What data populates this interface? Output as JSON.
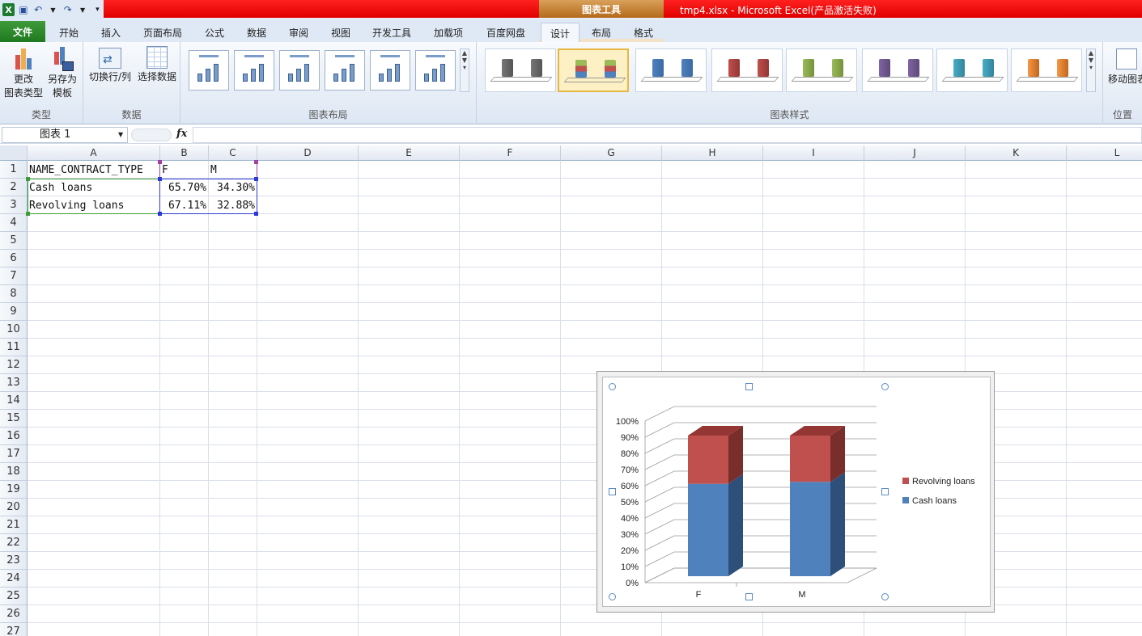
{
  "window": {
    "title": "tmp4.xlsx  -  Microsoft Excel(产品激活失败)",
    "context_group": "图表工具"
  },
  "ribbon_tabs": [
    {
      "label": "文件"
    },
    {
      "label": "开始"
    },
    {
      "label": "插入"
    },
    {
      "label": "页面布局"
    },
    {
      "label": "公式"
    },
    {
      "label": "数据"
    },
    {
      "label": "审阅"
    },
    {
      "label": "视图"
    },
    {
      "label": "开发工具"
    },
    {
      "label": "加载项"
    },
    {
      "label": "百度网盘"
    },
    {
      "label": "设计"
    },
    {
      "label": "布局"
    },
    {
      "label": "格式"
    }
  ],
  "ribbon": {
    "type_group": {
      "label": "类型",
      "change_type": "更改\n图表类型",
      "save_template": "另存为\n模板"
    },
    "data_group": {
      "label": "数据",
      "switch_row_col": "切换行/列",
      "select_data": "选择数据"
    },
    "layout_group": {
      "label": "图表布局"
    },
    "style_group": {
      "label": "图表样式"
    },
    "location_group": {
      "label": "位置",
      "move_chart": "移动图表"
    }
  },
  "name_box": "图表 1",
  "fx_label": "fx",
  "columns": [
    "A",
    "B",
    "C",
    "D",
    "E",
    "F",
    "G",
    "H",
    "I",
    "J",
    "K",
    "L"
  ],
  "rows": [
    "1",
    "2",
    "3",
    "4",
    "5",
    "6",
    "7",
    "8",
    "9",
    "10",
    "11",
    "12",
    "13",
    "14",
    "15",
    "16",
    "17",
    "18",
    "19",
    "20",
    "21",
    "22",
    "23",
    "24",
    "25",
    "26",
    "27"
  ],
  "cells": {
    "A1": "NAME_CONTRACT_TYPE",
    "B1": "F",
    "C1": "M",
    "A2": "Cash loans",
    "B2": "65.70%",
    "C2": "34.30%",
    "A3": "Revolving loans",
    "B3": "67.11%",
    "C3": "32.88%"
  },
  "colors": {
    "cash": "#4f81bd",
    "cash_dark": "#2e4f7a",
    "cash_top": "#3c6aa6",
    "revolving": "#c0504d",
    "revolving_dark": "#7a2e2c",
    "revolving_top": "#943634",
    "accent_file": "#2a8a2a"
  },
  "chart_data": {
    "type": "bar",
    "stacked": "100%",
    "three_d": true,
    "categories": [
      "F",
      "M"
    ],
    "series": [
      {
        "name": "Cash loans",
        "values": [
          65.7,
          67.11
        ]
      },
      {
        "name": "Revolving loans",
        "values": [
          34.3,
          32.88
        ]
      }
    ],
    "y_ticks": [
      "0%",
      "10%",
      "20%",
      "30%",
      "40%",
      "50%",
      "60%",
      "70%",
      "80%",
      "90%",
      "100%"
    ],
    "ylim": [
      0,
      100
    ],
    "legend": "right",
    "grid": true
  }
}
